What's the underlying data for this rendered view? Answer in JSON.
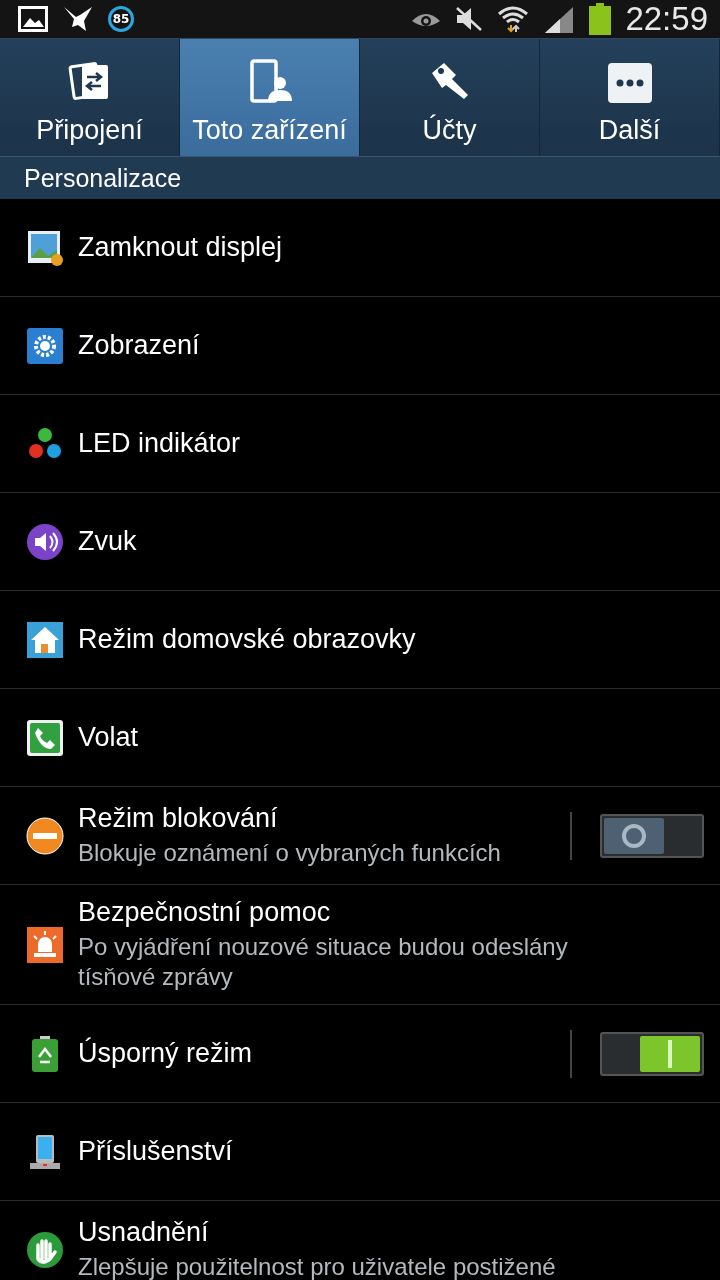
{
  "status_bar": {
    "battery_badge": "85",
    "time": "22:59"
  },
  "tabs": [
    {
      "label": "Připojení",
      "selected": false
    },
    {
      "label": "Toto zařízení",
      "selected": true
    },
    {
      "label": "Účty",
      "selected": false
    },
    {
      "label": "Další",
      "selected": false
    }
  ],
  "section": "Personalizace",
  "items": [
    {
      "title": "Zamknout displej"
    },
    {
      "title": "Zobrazení"
    },
    {
      "title": "LED indikátor"
    },
    {
      "title": "Zvuk"
    },
    {
      "title": "Režim domovské obrazovky"
    },
    {
      "title": "Volat"
    },
    {
      "title": "Režim blokování",
      "subtitle": "Blokuje oznámení o vybraných funkcích",
      "kind": "toggle",
      "on": false
    },
    {
      "title": "Bezpečnostní pomoc",
      "subtitle": "Po vyjádření nouzové situace budou odeslány tísňové zprávy"
    },
    {
      "title": "Úsporný režim",
      "kind": "toggle",
      "on": true
    },
    {
      "title": "Příslušenství"
    },
    {
      "title": "Usnadnění",
      "subtitle": "Zlepšuje použitelnost pro uživatele postižené"
    }
  ]
}
